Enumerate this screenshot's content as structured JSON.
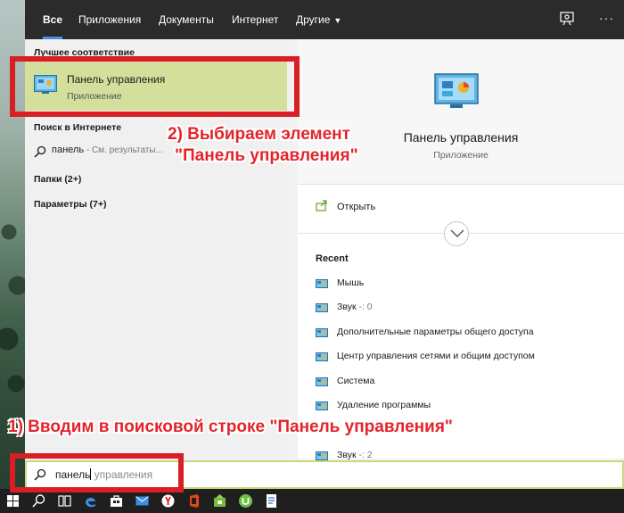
{
  "tabs": [
    {
      "label": "Все",
      "active": true
    },
    {
      "label": "Приложения"
    },
    {
      "label": "Документы"
    },
    {
      "label": "Интернет"
    },
    {
      "label": "Другие"
    }
  ],
  "left": {
    "best_match_title": "Лучшее соответствие",
    "best_match": {
      "name": "Панель управления",
      "type": "Приложение"
    },
    "web_title": "Поиск в Интернете",
    "web_query": "панель",
    "web_hint": " - См. результаты...",
    "folders": "Папки (2+)",
    "settings": "Параметры (7+)"
  },
  "preview": {
    "name": "Панель управления",
    "type": "Приложение",
    "open_label": "Открыть",
    "recent_title": "Recent",
    "recent": [
      {
        "label": "Мышь",
        "extra": ""
      },
      {
        "label": "Звук",
        "extra": " -: 0"
      },
      {
        "label": "Дополнительные параметры общего доступа",
        "extra": ""
      },
      {
        "label": "Центр управления сетями и общим доступом",
        "extra": ""
      },
      {
        "label": "Система",
        "extra": ""
      },
      {
        "label": "Удаление программы",
        "extra": ""
      },
      {
        "label": "Звук",
        "extra": " -: 2"
      }
    ]
  },
  "search": {
    "typed": "панель",
    "suggestion": " управления"
  },
  "annotations": {
    "step1": "1) Вводим в поисковой строке \"Панель управления\"",
    "step2_line1": "2) Выбираем элемент",
    "step2_line2": "\"Панель управления\""
  },
  "colors": {
    "highlight": "#d4df9c",
    "annotation_red": "#e3242b",
    "topbar": "#2b2b2b",
    "accent": "#4a8fe0"
  }
}
